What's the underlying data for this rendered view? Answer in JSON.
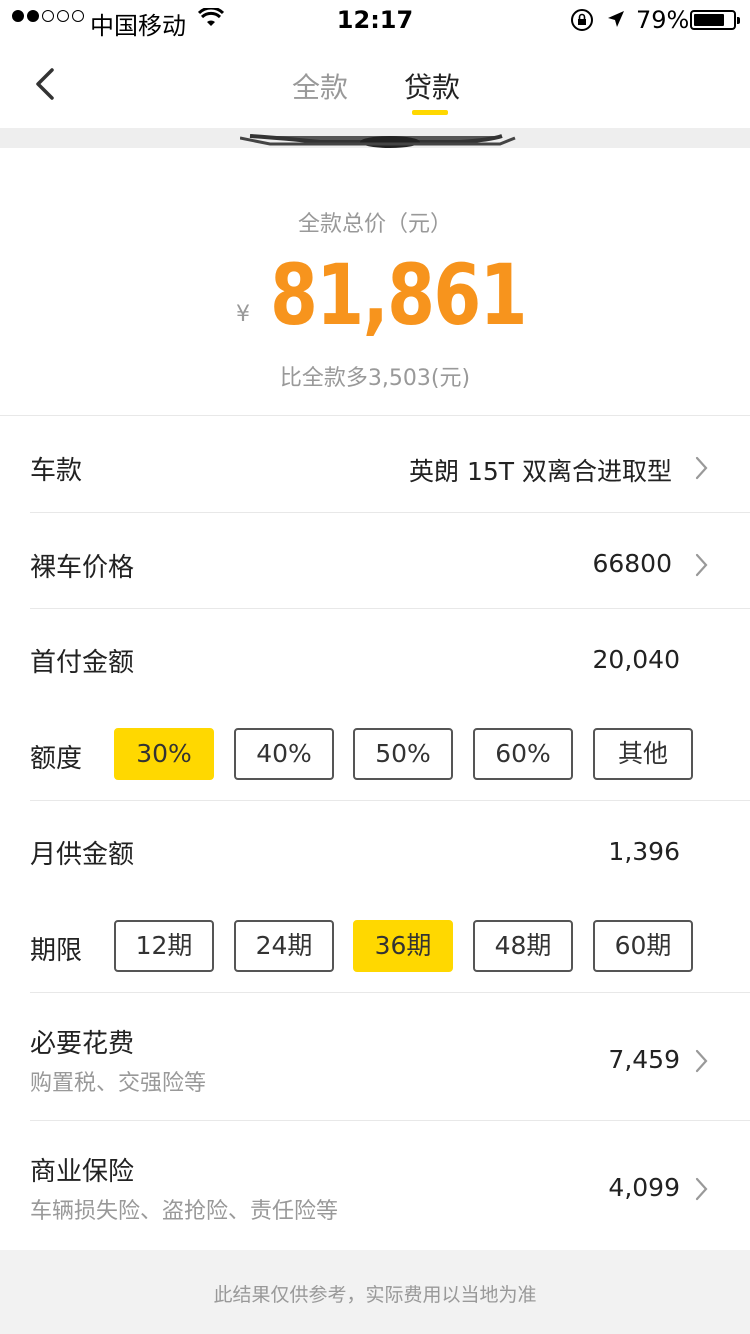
{
  "status_bar": {
    "carrier": "中国移动",
    "time": "12:17",
    "battery": "79%",
    "battery_level": 0.79
  },
  "nav": {
    "back_icon": "chevron-left-icon",
    "tabs": [
      {
        "label": "全款",
        "active": false
      },
      {
        "label": "贷款",
        "active": true
      }
    ],
    "accent_color": "#ffd800"
  },
  "summary": {
    "label": "全款总价（元）",
    "currency": "¥",
    "price": "81,861",
    "diff": "比全款多3,503(元)",
    "price_color": "#f7941d"
  },
  "rows": {
    "model": {
      "title": "车款",
      "value": "英朗 15T 双离合进取型"
    },
    "bare_price": {
      "title": "裸车价格",
      "value": "66800"
    },
    "down_payment": {
      "title": "首付金额",
      "value": "20,040"
    },
    "ratio": {
      "label": "额度",
      "options": [
        "30%",
        "40%",
        "50%",
        "60%",
        "其他"
      ],
      "selected": "30%"
    },
    "monthly": {
      "title": "月供金额",
      "value": "1,396"
    },
    "term": {
      "label": "期限",
      "options": [
        "12期",
        "24期",
        "36期",
        "48期",
        "60期"
      ],
      "selected": "36期"
    },
    "necessary": {
      "title": "必要花费",
      "sub": "购置税、交强险等",
      "value": "7,459"
    },
    "insurance": {
      "title": "商业保险",
      "sub": "车辆损失险、盗抢险、责任险等",
      "value": "4,099"
    }
  },
  "footer": {
    "note": "此结果仅供参考，实际费用以当地为准"
  }
}
